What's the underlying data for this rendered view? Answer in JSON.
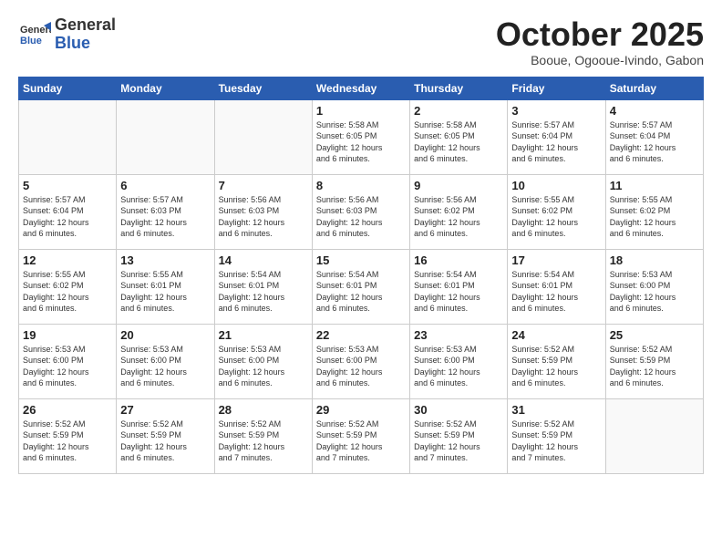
{
  "header": {
    "logo_general": "General",
    "logo_blue": "Blue",
    "month_title": "October 2025",
    "subtitle": "Booue, Ogooue-Ivindo, Gabon"
  },
  "days_of_week": [
    "Sunday",
    "Monday",
    "Tuesday",
    "Wednesday",
    "Thursday",
    "Friday",
    "Saturday"
  ],
  "weeks": [
    [
      {
        "day": "",
        "info": ""
      },
      {
        "day": "",
        "info": ""
      },
      {
        "day": "",
        "info": ""
      },
      {
        "day": "1",
        "info": "Sunrise: 5:58 AM\nSunset: 6:05 PM\nDaylight: 12 hours\nand 6 minutes."
      },
      {
        "day": "2",
        "info": "Sunrise: 5:58 AM\nSunset: 6:05 PM\nDaylight: 12 hours\nand 6 minutes."
      },
      {
        "day": "3",
        "info": "Sunrise: 5:57 AM\nSunset: 6:04 PM\nDaylight: 12 hours\nand 6 minutes."
      },
      {
        "day": "4",
        "info": "Sunrise: 5:57 AM\nSunset: 6:04 PM\nDaylight: 12 hours\nand 6 minutes."
      }
    ],
    [
      {
        "day": "5",
        "info": "Sunrise: 5:57 AM\nSunset: 6:04 PM\nDaylight: 12 hours\nand 6 minutes."
      },
      {
        "day": "6",
        "info": "Sunrise: 5:57 AM\nSunset: 6:03 PM\nDaylight: 12 hours\nand 6 minutes."
      },
      {
        "day": "7",
        "info": "Sunrise: 5:56 AM\nSunset: 6:03 PM\nDaylight: 12 hours\nand 6 minutes."
      },
      {
        "day": "8",
        "info": "Sunrise: 5:56 AM\nSunset: 6:03 PM\nDaylight: 12 hours\nand 6 minutes."
      },
      {
        "day": "9",
        "info": "Sunrise: 5:56 AM\nSunset: 6:02 PM\nDaylight: 12 hours\nand 6 minutes."
      },
      {
        "day": "10",
        "info": "Sunrise: 5:55 AM\nSunset: 6:02 PM\nDaylight: 12 hours\nand 6 minutes."
      },
      {
        "day": "11",
        "info": "Sunrise: 5:55 AM\nSunset: 6:02 PM\nDaylight: 12 hours\nand 6 minutes."
      }
    ],
    [
      {
        "day": "12",
        "info": "Sunrise: 5:55 AM\nSunset: 6:02 PM\nDaylight: 12 hours\nand 6 minutes."
      },
      {
        "day": "13",
        "info": "Sunrise: 5:55 AM\nSunset: 6:01 PM\nDaylight: 12 hours\nand 6 minutes."
      },
      {
        "day": "14",
        "info": "Sunrise: 5:54 AM\nSunset: 6:01 PM\nDaylight: 12 hours\nand 6 minutes."
      },
      {
        "day": "15",
        "info": "Sunrise: 5:54 AM\nSunset: 6:01 PM\nDaylight: 12 hours\nand 6 minutes."
      },
      {
        "day": "16",
        "info": "Sunrise: 5:54 AM\nSunset: 6:01 PM\nDaylight: 12 hours\nand 6 minutes."
      },
      {
        "day": "17",
        "info": "Sunrise: 5:54 AM\nSunset: 6:01 PM\nDaylight: 12 hours\nand 6 minutes."
      },
      {
        "day": "18",
        "info": "Sunrise: 5:53 AM\nSunset: 6:00 PM\nDaylight: 12 hours\nand 6 minutes."
      }
    ],
    [
      {
        "day": "19",
        "info": "Sunrise: 5:53 AM\nSunset: 6:00 PM\nDaylight: 12 hours\nand 6 minutes."
      },
      {
        "day": "20",
        "info": "Sunrise: 5:53 AM\nSunset: 6:00 PM\nDaylight: 12 hours\nand 6 minutes."
      },
      {
        "day": "21",
        "info": "Sunrise: 5:53 AM\nSunset: 6:00 PM\nDaylight: 12 hours\nand 6 minutes."
      },
      {
        "day": "22",
        "info": "Sunrise: 5:53 AM\nSunset: 6:00 PM\nDaylight: 12 hours\nand 6 minutes."
      },
      {
        "day": "23",
        "info": "Sunrise: 5:53 AM\nSunset: 6:00 PM\nDaylight: 12 hours\nand 6 minutes."
      },
      {
        "day": "24",
        "info": "Sunrise: 5:52 AM\nSunset: 5:59 PM\nDaylight: 12 hours\nand 6 minutes."
      },
      {
        "day": "25",
        "info": "Sunrise: 5:52 AM\nSunset: 5:59 PM\nDaylight: 12 hours\nand 6 minutes."
      }
    ],
    [
      {
        "day": "26",
        "info": "Sunrise: 5:52 AM\nSunset: 5:59 PM\nDaylight: 12 hours\nand 6 minutes."
      },
      {
        "day": "27",
        "info": "Sunrise: 5:52 AM\nSunset: 5:59 PM\nDaylight: 12 hours\nand 6 minutes."
      },
      {
        "day": "28",
        "info": "Sunrise: 5:52 AM\nSunset: 5:59 PM\nDaylight: 12 hours\nand 7 minutes."
      },
      {
        "day": "29",
        "info": "Sunrise: 5:52 AM\nSunset: 5:59 PM\nDaylight: 12 hours\nand 7 minutes."
      },
      {
        "day": "30",
        "info": "Sunrise: 5:52 AM\nSunset: 5:59 PM\nDaylight: 12 hours\nand 7 minutes."
      },
      {
        "day": "31",
        "info": "Sunrise: 5:52 AM\nSunset: 5:59 PM\nDaylight: 12 hours\nand 7 minutes."
      },
      {
        "day": "",
        "info": ""
      }
    ]
  ]
}
